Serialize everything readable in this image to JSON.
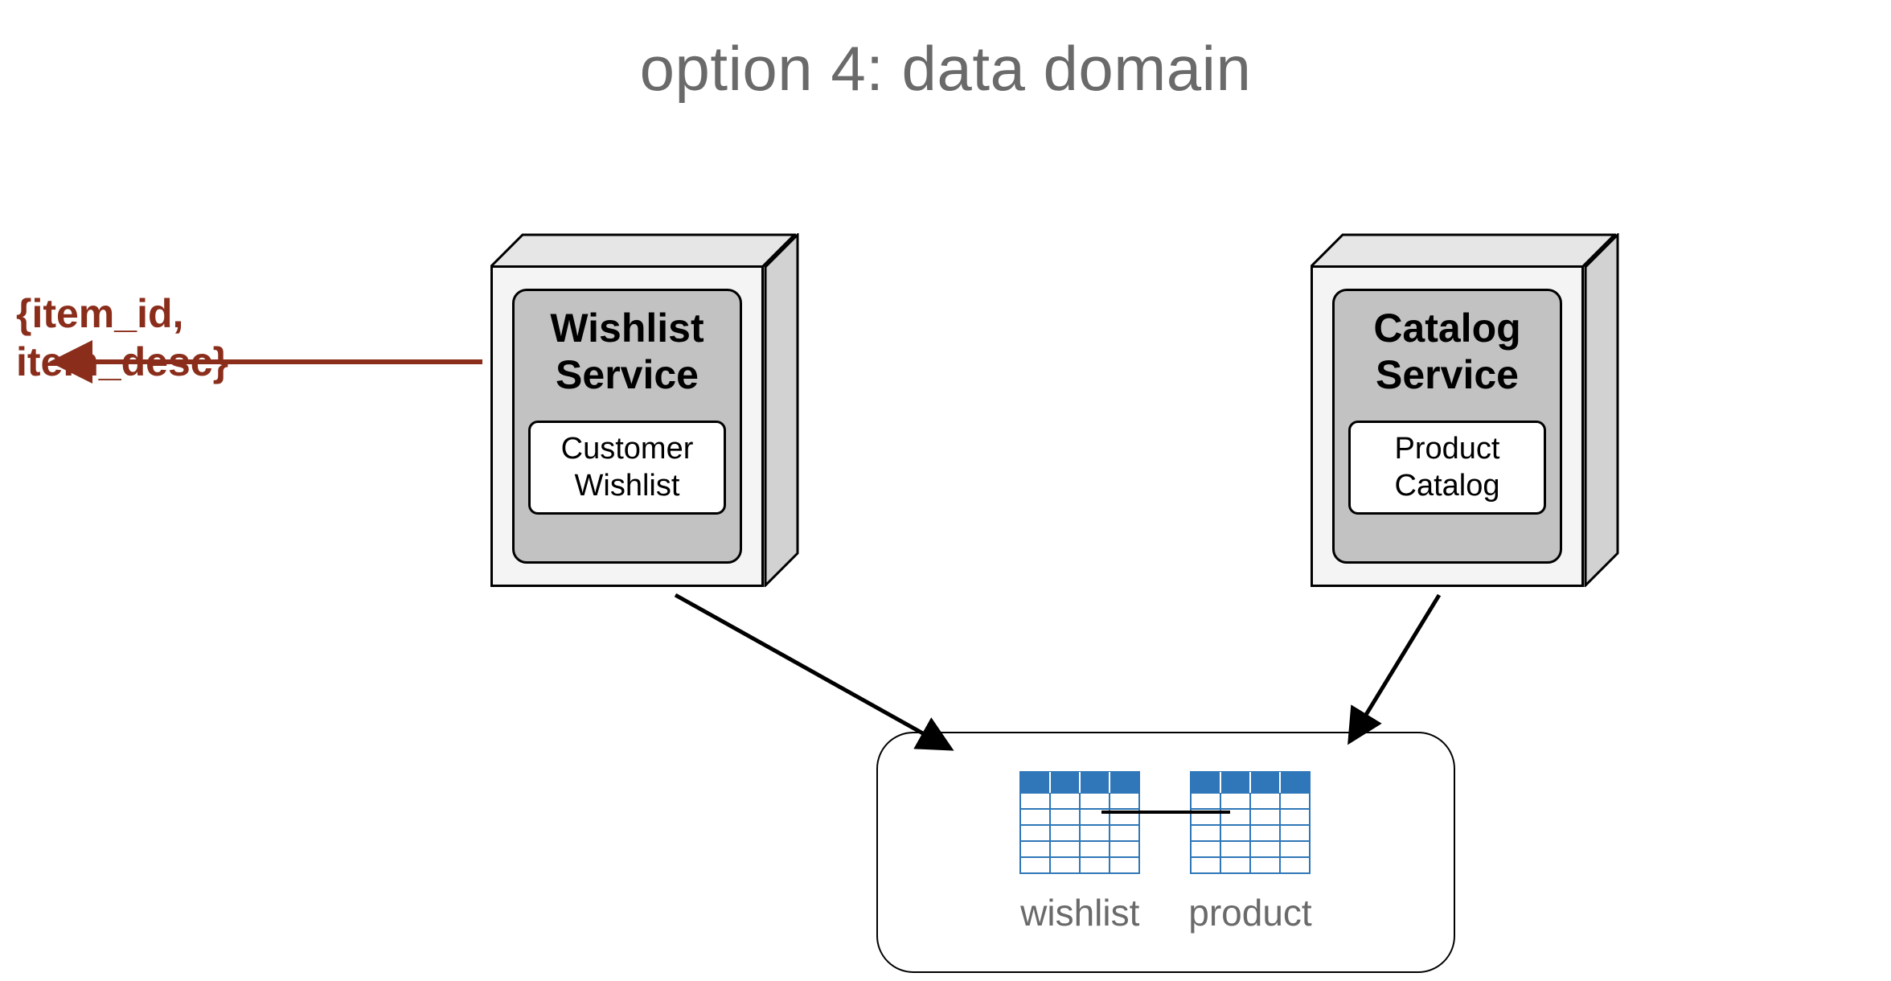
{
  "title": "option 4: data domain",
  "payload": {
    "line1": "{item_id,",
    "line2": " item_desc}"
  },
  "services": {
    "wishlist": {
      "title_line1": "Wishlist",
      "title_line2": "Service",
      "sub_line1": "Customer",
      "sub_line2": "Wishlist"
    },
    "catalog": {
      "title_line1": "Catalog",
      "title_line2": "Service",
      "sub_line1": "Product",
      "sub_line2": "Catalog"
    }
  },
  "domain": {
    "table_left": "wishlist",
    "table_right": "product"
  },
  "colors": {
    "title": "#6a6a6a",
    "payload": "#8a2d1b",
    "table_accent": "#2f77b8",
    "box_fill": "#f4f4f4",
    "inner_fill": "#c2c2c2"
  }
}
